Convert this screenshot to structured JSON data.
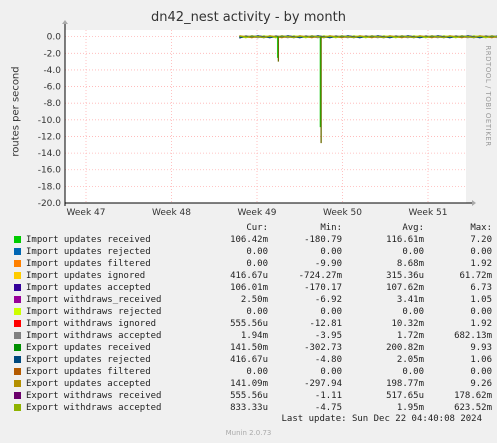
{
  "chart_data": {
    "type": "line",
    "title": "dn42_nest activity - by month",
    "ylabel": "routes per second",
    "ylim": [
      -20,
      0.8
    ],
    "yticks": [
      "0.0",
      "-2.0",
      "-4.0",
      "-6.0",
      "-8.0",
      "-10.0",
      "-12.0",
      "-14.0",
      "-16.0",
      "-18.0",
      "-20.0"
    ],
    "xticks": [
      "Week 47",
      "Week 48",
      "Week 49",
      "Week 50",
      "Week 51"
    ],
    "grid": true,
    "data_start_week": 48.8,
    "data_end_week": 51.9,
    "dips": [
      {
        "week": 49.25,
        "value": -3.0
      },
      {
        "week": 49.75,
        "value": -12.8
      }
    ],
    "columns": [
      "Cur:",
      "Min:",
      "Avg:",
      "Max:"
    ],
    "series": [
      {
        "name": "Import updates received",
        "color": "#00cc00",
        "cur": "106.42m",
        "min": "-180.79",
        "avg": "116.61m",
        "max": "7.20"
      },
      {
        "name": "Import updates rejected",
        "color": "#0066b3",
        "cur": "0.00",
        "min": "0.00",
        "avg": "0.00",
        "max": "0.00"
      },
      {
        "name": "Import updates filtered",
        "color": "#ff8000",
        "cur": "0.00",
        "min": "-9.90",
        "avg": "8.68m",
        "max": "1.92"
      },
      {
        "name": "Import updates ignored",
        "color": "#ffcc00",
        "cur": "416.67u",
        "min": "-724.27m",
        "avg": "315.36u",
        "max": "61.72m"
      },
      {
        "name": "Import updates accepted",
        "color": "#330099",
        "cur": "106.01m",
        "min": "-170.17",
        "avg": "107.62m",
        "max": "6.73"
      },
      {
        "name": "Import withdraws_received",
        "color": "#990099",
        "cur": "2.50m",
        "min": "-6.92",
        "avg": "3.41m",
        "max": "1.05"
      },
      {
        "name": "Import withdraws rejected",
        "color": "#ccff00",
        "cur": "0.00",
        "min": "0.00",
        "avg": "0.00",
        "max": "0.00"
      },
      {
        "name": "Import withdraws ignored",
        "color": "#ff0000",
        "cur": "555.56u",
        "min": "-12.81",
        "avg": "10.32m",
        "max": "1.92"
      },
      {
        "name": "Import withdraws accepted",
        "color": "#808080",
        "cur": "1.94m",
        "min": "-3.95",
        "avg": "1.72m",
        "max": "682.13m"
      },
      {
        "name": "Export updates received",
        "color": "#008f00",
        "cur": "141.50m",
        "min": "-302.73",
        "avg": "200.82m",
        "max": "9.93"
      },
      {
        "name": "Export updates rejected",
        "color": "#00487d",
        "cur": "416.67u",
        "min": "-4.80",
        "avg": "2.05m",
        "max": "1.06"
      },
      {
        "name": "Export updates filtered",
        "color": "#b35a00",
        "cur": "0.00",
        "min": "0.00",
        "avg": "0.00",
        "max": "0.00"
      },
      {
        "name": "Export updates accepted",
        "color": "#b38f00",
        "cur": "141.09m",
        "min": "-297.94",
        "avg": "198.77m",
        "max": "9.26"
      },
      {
        "name": "Export withdraws received",
        "color": "#6b006b",
        "cur": "555.56u",
        "min": "-1.11",
        "avg": "517.65u",
        "max": "178.62m"
      },
      {
        "name": "Export withdraws accepted",
        "color": "#8fb300",
        "cur": "833.33u",
        "min": "-4.75",
        "avg": "1.95m",
        "max": "623.52m"
      }
    ]
  },
  "side_text": "RRDTOOL / TOBI OETIKER",
  "last_update": "Last update: Sun Dec 22 04:40:08 2024",
  "footer": "Munin 2.0.73"
}
